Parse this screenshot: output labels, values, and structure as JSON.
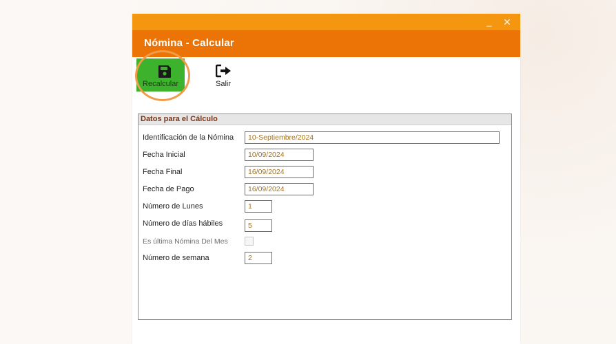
{
  "window": {
    "minimize_symbol": "_",
    "close_symbol": "✕"
  },
  "header": {
    "title": "Nómina - Calcular"
  },
  "toolbar": {
    "recalcular_label": "Recalcular",
    "recalcular_icon": "floppy-disk-icon",
    "salir_label": "Salir",
    "salir_icon": "exit-arrow-icon",
    "recalcular_color": "#3db22c"
  },
  "group": {
    "title": "Datos para el Cálculo",
    "fields": {
      "identificacion": {
        "label": "Identificación de la Nómina",
        "value": "10-Septiembre/2024"
      },
      "fecha_inicial": {
        "label": "Fecha Inicial",
        "value": "10/09/2024"
      },
      "fecha_final": {
        "label": "Fecha Final",
        "value": "16/09/2024"
      },
      "fecha_pago": {
        "label": "Fecha de Pago",
        "value": "16/09/2024"
      },
      "numero_lunes": {
        "label": "Número de Lunes",
        "value": "1"
      },
      "dias_habiles": {
        "label": "Número de días hábiles",
        "value": "5"
      },
      "ultima_nomina": {
        "label": "Es última Nómina Del Mes",
        "checked": false
      },
      "numero_semana": {
        "label": "Número de semana",
        "value": "2"
      }
    }
  },
  "colors": {
    "titlebar": "#f4960f",
    "header": "#ec7407",
    "value_text": "#a3731d",
    "group_title": "#7a3416"
  }
}
